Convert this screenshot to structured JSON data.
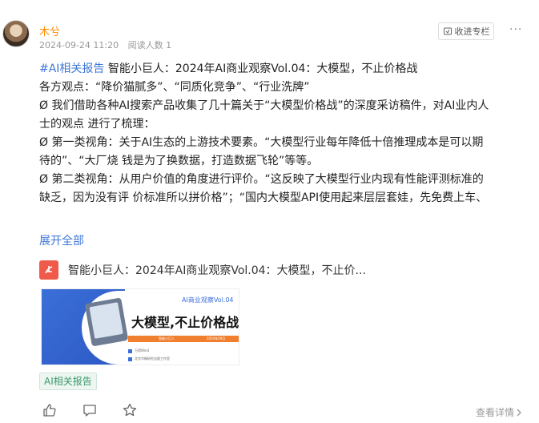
{
  "author": {
    "name": "木兮",
    "date": "2024-09-24 11:20",
    "read_count": "阅读人数 1"
  },
  "header": {
    "collect_label": "收进专栏",
    "more_icon": "more-icon"
  },
  "post": {
    "tag_link": "#AI相关报告",
    "line1_rest": " 智能小巨人：2024年AI商业观察Vol.04：大模型，不止价格战",
    "line2": "各方观点：“降价猫腻多”、“同质化竞争”、“行业洗牌”",
    "line3": "Ø 我们借助各种AI搜索产品收集了几十篇关于“大模型价格战”的深度采访稿件，对AI业内人",
    "line4": "士的观点 进行了梳理：",
    "line5": "Ø 第一类视角：关于AI生态的上游技术要素。“大模型行业每年降低十倍推理成本是可以期",
    "line6": "待的”、“大厂烧 钱是为了换数据，打造数据飞轮”等等。",
    "line7": "Ø 第二类视角：从用户价值的角度进行评价。“这反映了大模型行业内现有性能评测标准的",
    "line8": "缺乏，因为没有评 价标准所以拼价格”；“国内大模型API使用起来层层套娃，先免费上车、",
    "expand_label": "展开全部"
  },
  "attachment": {
    "icon": "pdf-icon",
    "title": "智能小巨人：2024年AI商业观察Vol.04：大模型，不止价..."
  },
  "thumbnail": {
    "series": "AI商业观察Vol.04",
    "headline": "大模型,不止价格战",
    "bar_left": "智能小巨人",
    "bar_right": "2024年09月",
    "line_a": "万得Wind",
    "line_b": "北京华翰研究出版工作室"
  },
  "tag_chip": "AI相关报告",
  "actions": {
    "like_icon": "thumbs-up-icon",
    "comment_icon": "comment-icon",
    "star_icon": "star-icon"
  },
  "detail_link": "查看详情",
  "colors": {
    "accent_orange": "#ff8a00",
    "link_blue": "#3e76d6",
    "tag_green": "#3a9a6a",
    "pdf_red": "#f05a4a"
  }
}
